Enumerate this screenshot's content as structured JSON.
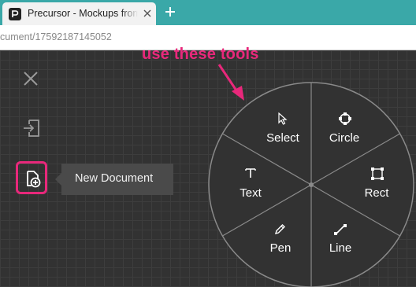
{
  "browser": {
    "tab_title": "Precursor - Mockups from",
    "url": "cument/17592187145052",
    "colors": {
      "titlebar": "#3aa8a8"
    }
  },
  "sidebar": {
    "close_icon": "close-icon",
    "exit_icon": "sign-in-icon",
    "new_document_icon": "new-document-icon"
  },
  "tooltip": {
    "label": "New Document"
  },
  "annotation": {
    "text": "use these tools",
    "color": "#e8287b"
  },
  "tool_wheel": {
    "tools": [
      {
        "label": "Select",
        "icon": "cursor-icon"
      },
      {
        "label": "Circle",
        "icon": "circle-icon"
      },
      {
        "label": "Text",
        "icon": "text-icon"
      },
      {
        "label": "Rect",
        "icon": "rect-icon"
      },
      {
        "label": "Pen",
        "icon": "pen-icon"
      },
      {
        "label": "Line",
        "icon": "line-icon"
      }
    ]
  }
}
